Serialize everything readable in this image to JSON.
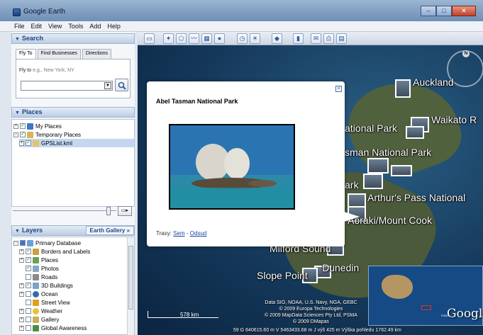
{
  "window": {
    "title": "Google Earth"
  },
  "menu": [
    "File",
    "Edit",
    "View",
    "Tools",
    "Add",
    "Help"
  ],
  "search": {
    "header": "Search",
    "tabs": [
      "Fly To",
      "Find Businesses",
      "Directions"
    ],
    "flyto_label": "Fly to",
    "flyto_placeholder": "e.g., New York, NY",
    "input_value": ""
  },
  "places": {
    "header": "Places",
    "items": [
      {
        "label": "My Places",
        "checked": true,
        "selected": false
      },
      {
        "label": "Temporary Places",
        "checked": true,
        "selected": false
      },
      {
        "label": "GPSList.kml",
        "checked": true,
        "selected": true
      }
    ]
  },
  "layers": {
    "header": "Layers",
    "gallery_button": "Earth Gallery »",
    "items": [
      {
        "label": "Primary Database",
        "checked": true
      },
      {
        "label": "Borders and Labels",
        "checked": true
      },
      {
        "label": "Places",
        "checked": true
      },
      {
        "label": "Photos",
        "checked": true
      },
      {
        "label": "Roads",
        "checked": false
      },
      {
        "label": "3D Buildings",
        "checked": true
      },
      {
        "label": "Ocean",
        "checked": false
      },
      {
        "label": "Street View",
        "checked": false
      },
      {
        "label": "Weather",
        "checked": false
      },
      {
        "label": "Gallery",
        "checked": false
      },
      {
        "label": "Global Awareness",
        "checked": false
      }
    ]
  },
  "map": {
    "labels": [
      "Auckland",
      "Waikato R",
      "ational Park",
      "sman National Park",
      "ark",
      "Arthur's Pass National",
      "Aoraki/Mount Cook",
      "Milford Sound",
      "Slope Point",
      "Dunedin"
    ],
    "balloon": {
      "title": "Abel Tasman National Park",
      "links_prefix": "Trasy:",
      "link_there": "Sem",
      "separator": "-",
      "link_from": "Odsud"
    },
    "compass_n": "N",
    "scale_text": "578 km",
    "credits": [
      "Data SIO, NOAA, U.S. Navy, NGA, GEBC",
      "© 2009 Europa Technologies",
      "© 2009 MapData Sciences Pty Ltd, PSMA",
      "© 2009 DMapas"
    ],
    "status": "59 G 640615.60 m V 5463433.68 m J   výš   425 m           Výška pohledu  1762.49 km",
    "logo": "Google",
    "logo_small": "©2009"
  }
}
